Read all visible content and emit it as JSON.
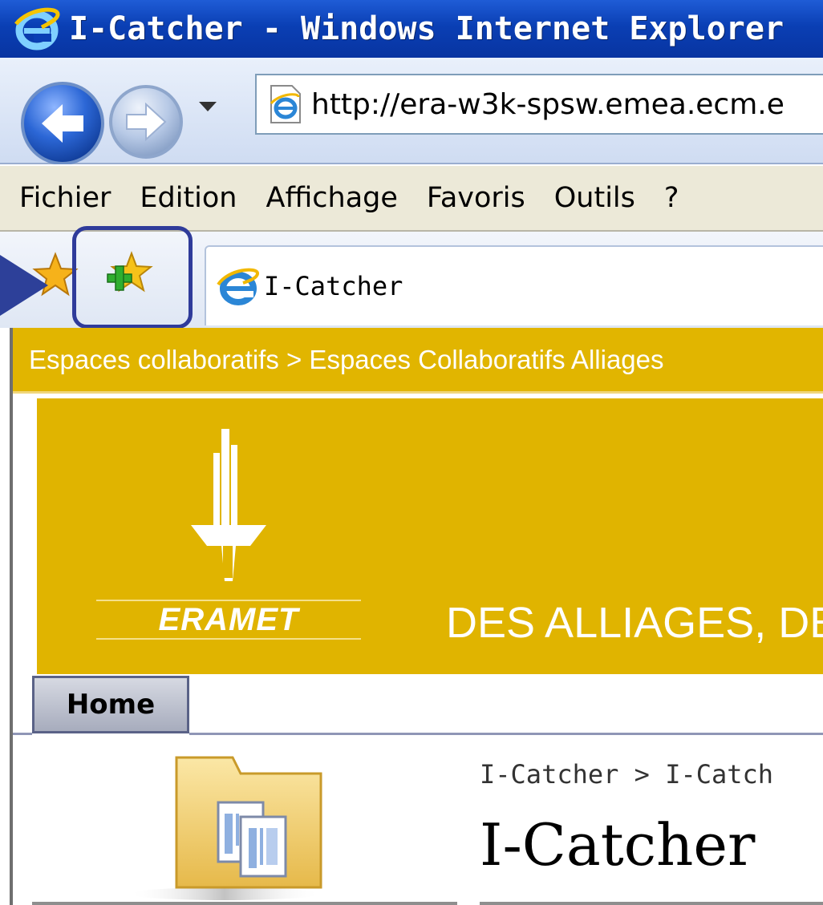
{
  "window": {
    "title": "I-Catcher - Windows Internet Explorer"
  },
  "navigation": {
    "address_url": "http://era-w3k-spsw.emea.ecm.e"
  },
  "menu": {
    "items": [
      "Fichier",
      "Edition",
      "Affichage",
      "Favoris",
      "Outils",
      "?"
    ]
  },
  "tabs": [
    {
      "label": "I-Catcher"
    }
  ],
  "page": {
    "breadcrumb": "Espaces collaboratifs > Espaces Collaboratifs Alliages",
    "logo_text": "ERAMET",
    "slogan": "DES ALLIAGES, DE",
    "home_tab": "Home",
    "site_breadcrumb": "I-Catcher > I-Catch",
    "site_title": "I-Catcher"
  },
  "colors": {
    "titlebar": "#0a3fb4",
    "banner": "#e0b400",
    "highlight": "#2f3b9a"
  },
  "icons": [
    "ie-logo-icon",
    "back-arrow-icon",
    "forward-arrow-icon",
    "favorites-star-icon",
    "add-favorite-icon",
    "folder-documents-icon"
  ]
}
